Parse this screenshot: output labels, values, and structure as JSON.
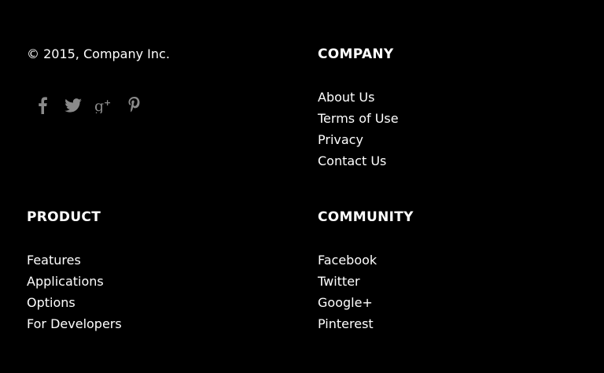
{
  "footer": {
    "copyright": "© 2015, Company Inc.",
    "social_icons": [
      "facebook-icon",
      "twitter-icon",
      "google-plus-icon",
      "pinterest-icon"
    ],
    "icon_color": "#8a8a8a",
    "company": {
      "heading": "COMPANY",
      "links": [
        "About Us",
        "Terms of Use",
        "Privacy",
        "Contact Us"
      ]
    },
    "product": {
      "heading": "PRODUCT",
      "links": [
        "Features",
        "Applications",
        "Options",
        "For Developers"
      ]
    },
    "community": {
      "heading": "COMMUNITY",
      "links": [
        "Facebook",
        "Twitter",
        "Google+",
        "Pinterest"
      ]
    }
  }
}
